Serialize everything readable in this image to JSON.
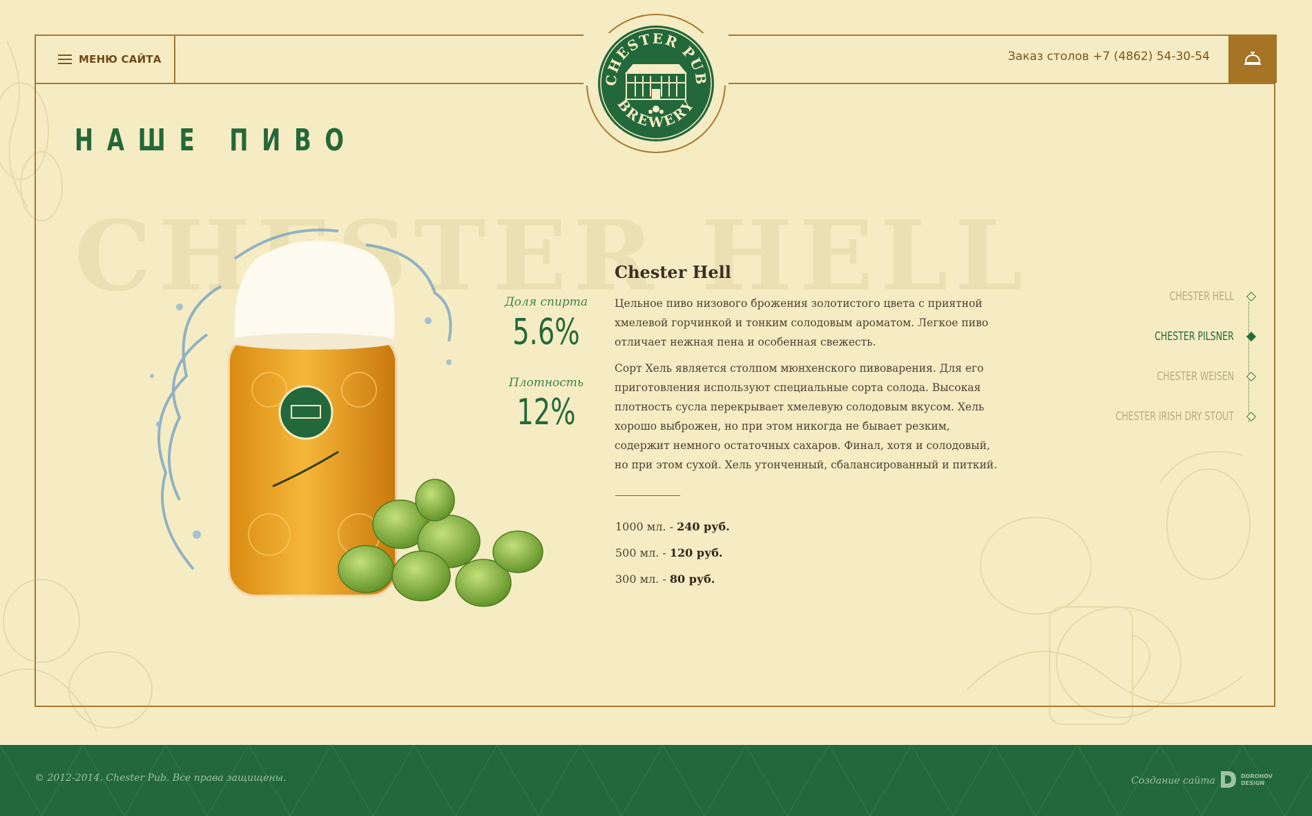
{
  "header": {
    "menu_label": "МЕНЮ САЙТА",
    "phone": "Заказ столов +7 (4862) 54-30-54"
  },
  "logo": {
    "top_text": "CHESTER PUB",
    "bottom_text": "BREWERY"
  },
  "page": {
    "title": "НАШЕ ПИВО",
    "background_word": "CHESTER HELL"
  },
  "beer": {
    "name": "Chester Hell",
    "abv_label": "Доля спирта",
    "abv_value": "5.6%",
    "density_label": "Плотность",
    "density_value": "12%",
    "description_1": "Цельное пиво низового брожения золотистого цвета с приятной хмелевой горчинкой и тонким солодовым ароматом. Легкое пиво отличает нежная пена и особенная свежесть.",
    "description_2": "Сорт Хель является столпом мюнхенского пивоварения. Для его приготовления используют специальные сорта солода. Высокая плотность сусла перекрывает хмелевую солодовым вкусом. Хель хорошо выброжен, но при этом никогда не бывает резким, содержит немного остаточных сахаров. Финал, хотя и солодовый, но при этом сухой. Хель утонченный, сбалансированный и питкий.",
    "prices": [
      {
        "volume": "1000 мл. - ",
        "price": "240 руб."
      },
      {
        "volume": "500 мл. - ",
        "price": "120 руб."
      },
      {
        "volume": "300 мл. - ",
        "price": "80 руб."
      }
    ]
  },
  "beer_nav": [
    {
      "label": "Chester Hell",
      "active": false
    },
    {
      "label": "Chester Pilsner",
      "active": true
    },
    {
      "label": "Chester Weisen",
      "active": false
    },
    {
      "label": "Chester Irish Dry Stout",
      "active": false
    }
  ],
  "footer": {
    "copyright": "© 2012-2014. Chester Pub. Все права защищены.",
    "credit": "Создание сайта",
    "studio_line1": "DOROHOV",
    "studio_line2": "DESIGN"
  },
  "colors": {
    "background": "#f6ecc3",
    "frame": "#a5772c",
    "brand_green": "#24683a",
    "footer_green": "#22683a",
    "bell_button": "#a57424"
  },
  "icons": {
    "menu": "hamburger-icon",
    "reserve": "service-bell-icon",
    "studio": "dorohov-design-logo"
  }
}
